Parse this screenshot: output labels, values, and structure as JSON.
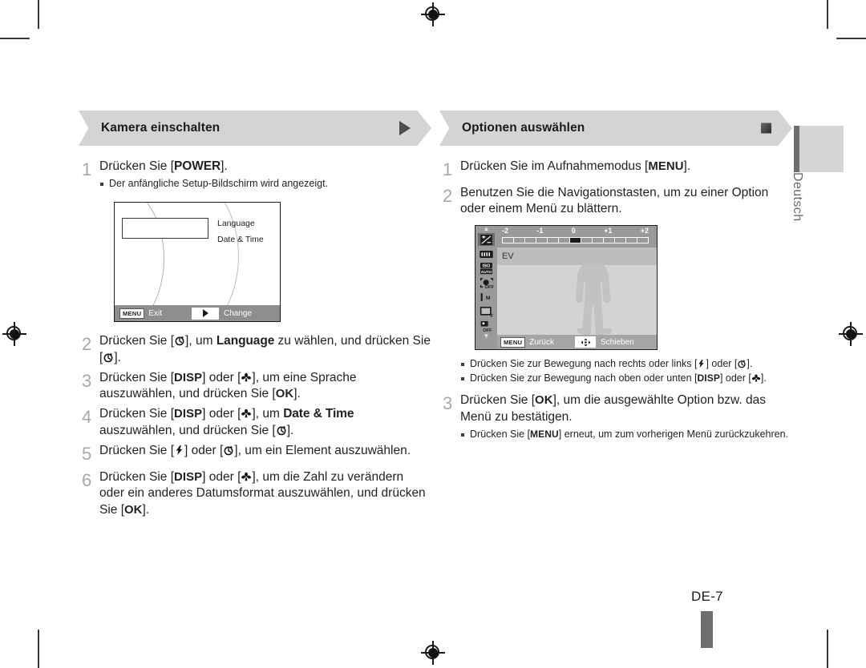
{
  "page": {
    "number_label": "DE-7",
    "language_tab": "Deutsch"
  },
  "left_column": {
    "header": {
      "title": "Kamera einschalten",
      "marker_icon": "triangle-right-icon"
    },
    "steps": [
      {
        "num": "1",
        "text_parts": [
          {
            "t": "Drücken Sie [",
            "style": "normal"
          },
          {
            "t": "POWER",
            "style": "bold"
          },
          {
            "t": "].",
            "style": "normal"
          }
        ],
        "bullets": [
          "Der anfängliche Setup-Bildschirm wird angezeigt."
        ]
      },
      {
        "num": "2",
        "text_parts": [
          {
            "t": "Drücken Sie [",
            "style": "normal"
          },
          {
            "t": "",
            "style": "icon-timer"
          },
          {
            "t": "], um ",
            "style": "normal"
          },
          {
            "t": "Language",
            "style": "bold"
          },
          {
            "t": " zu wählen, und drücken Sie [",
            "style": "normal"
          },
          {
            "t": "",
            "style": "icon-timer"
          },
          {
            "t": "].",
            "style": "normal"
          }
        ],
        "bullets": []
      },
      {
        "num": "3",
        "text_parts": [
          {
            "t": "Drücken Sie [",
            "style": "normal"
          },
          {
            "t": "DISP",
            "style": "bold-mono"
          },
          {
            "t": "] oder [",
            "style": "normal"
          },
          {
            "t": "",
            "style": "icon-macro"
          },
          {
            "t": "], um eine Sprache auszuwählen, und drücken Sie [",
            "style": "normal"
          },
          {
            "t": "OK",
            "style": "bold-mono"
          },
          {
            "t": "].",
            "style": "normal"
          }
        ],
        "bullets": []
      },
      {
        "num": "4",
        "text_parts": [
          {
            "t": "Drücken Sie [",
            "style": "normal"
          },
          {
            "t": "DISP",
            "style": "bold-mono"
          },
          {
            "t": "] oder [",
            "style": "normal"
          },
          {
            "t": "",
            "style": "icon-macro"
          },
          {
            "t": "], um ",
            "style": "normal"
          },
          {
            "t": "Date & Time",
            "style": "bold"
          },
          {
            "t": " auszuwählen, und drücken Sie [",
            "style": "normal"
          },
          {
            "t": "",
            "style": "icon-timer"
          },
          {
            "t": "].",
            "style": "normal"
          }
        ],
        "bullets": []
      },
      {
        "num": "5",
        "text_parts": [
          {
            "t": "Drücken Sie [",
            "style": "normal"
          },
          {
            "t": "",
            "style": "icon-flash"
          },
          {
            "t": "] oder [",
            "style": "normal"
          },
          {
            "t": "",
            "style": "icon-timer"
          },
          {
            "t": "], um ein Element auszuwählen.",
            "style": "normal"
          }
        ],
        "bullets": []
      },
      {
        "num": "6",
        "text_parts": [
          {
            "t": "Drücken Sie [",
            "style": "normal"
          },
          {
            "t": "DISP",
            "style": "bold-mono"
          },
          {
            "t": "] oder [",
            "style": "normal"
          },
          {
            "t": "",
            "style": "icon-macro"
          },
          {
            "t": "], um die Zahl zu verändern oder ein anderes Datumsformat auszuwählen, und drücken Sie [",
            "style": "normal"
          },
          {
            "t": "OK",
            "style": "bold-mono"
          },
          {
            "t": "].",
            "style": "normal"
          }
        ],
        "bullets": []
      }
    ],
    "setup_screen": {
      "menu_items": [
        "Language",
        "Date & Time"
      ],
      "bottom_bar": {
        "menu_badge": "MENU",
        "left_label": "Exit",
        "chip_icon": "triangle-right-icon",
        "right_label": "Change"
      }
    }
  },
  "right_column": {
    "header": {
      "title": "Optionen auswählen",
      "marker_icon": "square-icon"
    },
    "steps": [
      {
        "num": "1",
        "text_parts": [
          {
            "t": "Drücken Sie im Aufnahmemodus [",
            "style": "normal"
          },
          {
            "t": "MENU",
            "style": "bold-mono"
          },
          {
            "t": "].",
            "style": "normal"
          }
        ],
        "bullets": []
      },
      {
        "num": "2",
        "text_parts": [
          {
            "t": "Benutzen Sie die Navigationstasten, um zu einer Option oder einem Menü zu blättern.",
            "style": "normal"
          }
        ],
        "bullets": []
      },
      {
        "num": "3",
        "text_parts": [
          {
            "t": "Drücken Sie [",
            "style": "normal"
          },
          {
            "t": "OK",
            "style": "bold-mono"
          },
          {
            "t": "], um die ausgewählte Option bzw. das Menü zu bestätigen.",
            "style": "normal"
          }
        ],
        "bullets": []
      }
    ],
    "nav_bullets": [
      {
        "parts": [
          {
            "t": "Drücken Sie zur Bewegung nach rechts oder links [",
            "style": "normal"
          },
          {
            "t": "",
            "style": "icon-flash"
          },
          {
            "t": "] oder [",
            "style": "normal"
          },
          {
            "t": "",
            "style": "icon-timer"
          },
          {
            "t": "].",
            "style": "normal"
          }
        ]
      },
      {
        "parts": [
          {
            "t": "Drücken Sie zur Bewegung nach oben oder unten [",
            "style": "normal"
          },
          {
            "t": "DISP",
            "style": "bold-mono"
          },
          {
            "t": "] oder [",
            "style": "normal"
          },
          {
            "t": "",
            "style": "icon-macro"
          },
          {
            "t": "].",
            "style": "normal"
          }
        ]
      }
    ],
    "confirm_bullet": {
      "parts": [
        {
          "t": "Drücken Sie [",
          "style": "normal"
        },
        {
          "t": "MENU",
          "style": "bold-mono"
        },
        {
          "t": "] erneut, um zum vorherigen Menü zurückzukehren.",
          "style": "normal"
        }
      ]
    },
    "ev_screen": {
      "scale_labels": [
        "-2",
        "-1",
        "0",
        "+1",
        "+2"
      ],
      "tick_count": 13,
      "tick_selected_index": 6,
      "ev_label": "EV",
      "sidebar_icons": [
        "exposure-compensation-icon",
        "white-balance-icon",
        "iso-auto-icon",
        "face-detection-off-icon",
        "focus-area-icon",
        "metering-icon",
        "drive-off-icon"
      ],
      "bottom_bar": {
        "menu_badge": "MENU",
        "left_label": "Zurück",
        "nav_icon": "4-way-nav-icon",
        "right_label": "Schieben"
      }
    }
  },
  "colors": {
    "banner_gray": "#d4d4d4",
    "step_num_gray": "#a8a8a8",
    "lcd_bar_gray": "#8e8e8e",
    "ev_sidebar_gray": "#9a9a9a",
    "tab_gray": "#d6d6d6",
    "tab_bar_gray": "#6e6e6e",
    "text_black": "#231f20"
  }
}
